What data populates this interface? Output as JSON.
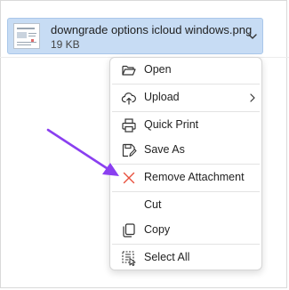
{
  "attachment": {
    "file_name": "downgrade options icloud windows.png",
    "file_size": "19 KB"
  },
  "context_menu": {
    "items": [
      {
        "label": "Open",
        "icon": "folder-open-icon"
      },
      {
        "label": "Upload",
        "icon": "cloud-upload-icon",
        "has_submenu": true
      },
      {
        "label": "Quick Print",
        "icon": "printer-icon"
      },
      {
        "label": "Save As",
        "icon": "save-as-icon"
      },
      {
        "label": "Remove Attachment",
        "icon": "remove-x-icon"
      },
      {
        "label": "Cut",
        "icon": ""
      },
      {
        "label": "Copy",
        "icon": "copy-icon"
      },
      {
        "label": "Select All",
        "icon": "select-all-icon"
      }
    ]
  },
  "colors": {
    "attachment_bg": "#c7dcf4",
    "remove_icon": "#e8523f",
    "annotation_arrow": "#8a3ff0"
  }
}
